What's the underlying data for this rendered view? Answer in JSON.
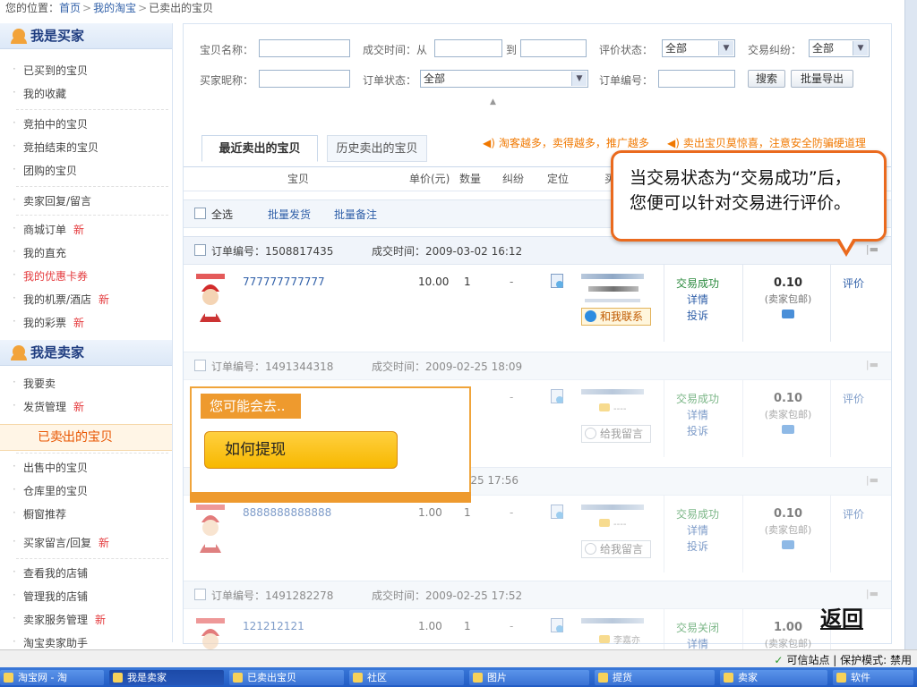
{
  "breadcrumb": {
    "prefix": "您的位置：",
    "home": "首页",
    "mytaobao": "我的淘宝",
    "current": "已卖出的宝贝",
    "sep": ">"
  },
  "sidebar": {
    "buyer_title": "我是买家",
    "buyer_items": [
      {
        "label": "已买到的宝贝",
        "new": ""
      },
      {
        "label": "我的收藏",
        "new": ""
      },
      {
        "label": "竞拍中的宝贝",
        "new": ""
      },
      {
        "label": "竞拍结束的宝贝",
        "new": ""
      },
      {
        "label": "团购的宝贝",
        "new": ""
      },
      {
        "label": "卖家回复/留言",
        "new": ""
      },
      {
        "label": "商城订单",
        "new": "新"
      },
      {
        "label": "我的直充",
        "new": ""
      },
      {
        "label": "我的优惠卡券",
        "new": ""
      },
      {
        "label": "我的机票/酒店",
        "new": "新"
      },
      {
        "label": "我的彩票",
        "new": "新"
      }
    ],
    "seller_title": "我是卖家",
    "seller_items": [
      {
        "label": "我要卖",
        "new": ""
      },
      {
        "label": "发货管理",
        "new": "新"
      },
      {
        "label": "已卖出的宝贝",
        "new": ""
      },
      {
        "label": "出售中的宝贝",
        "new": ""
      },
      {
        "label": "仓库里的宝贝",
        "new": ""
      },
      {
        "label": "橱窗推荐",
        "new": ""
      },
      {
        "label": "买家留言/回复",
        "new": "新"
      },
      {
        "label": "查看我的店铺",
        "new": ""
      },
      {
        "label": "管理我的店铺",
        "new": ""
      },
      {
        "label": "卖家服务管理",
        "new": "新"
      },
      {
        "label": "淘宝卖家助手",
        "new": ""
      }
    ]
  },
  "search": {
    "item_name": "宝贝名称：",
    "deal_time_from": "成交时间：从",
    "to": "到",
    "rating_status": "评价状态：",
    "rating_value": "全部",
    "dispute": "交易纠纷：",
    "dispute_value": "全部",
    "buyer_nick": "买家昵称：",
    "order_status": "订单状态：",
    "order_status_value": "全部",
    "order_no": "订单编号：",
    "search_btn": "搜索",
    "export_btn": "批量导出",
    "collapse": "▲"
  },
  "tabs": {
    "recent": "最近卖出的宝贝",
    "history": "历史卖出的宝贝"
  },
  "notices": {
    "n1": "淘客越多，卖得越多，推广越多",
    "n2": "卖出宝贝莫惊喜，注意安全防骗硬道理"
  },
  "columns": {
    "item": "宝贝",
    "price": "单价(元)",
    "qty": "数量",
    "dispute": "纠纷",
    "locate": "定位",
    "more": "买"
  },
  "toolbar": {
    "select_all": "全选",
    "batch_ship": "批量发货",
    "batch_note": "批量备注"
  },
  "orders": [
    {
      "order_label": "订单编号：",
      "order_no": "1508817435",
      "time_label": "成交时间：",
      "time": "2009-03-02 16:12",
      "item": "777777777777",
      "price": "10.00",
      "qty": "1",
      "dispute": "-",
      "status": "交易成功",
      "detail": "详情",
      "complain": "投诉",
      "amount": "0.10",
      "shipping": "(卖家包邮)",
      "rate": "评价",
      "contact": "和我联系"
    },
    {
      "order_label": "订单编号：",
      "order_no": "1491344318",
      "time_label": "成交时间：",
      "time": "2009-02-25 18:09",
      "item": "",
      "price": "",
      "qty": "",
      "dispute": "-",
      "status": "交易成功",
      "detail": "详情",
      "complain": "投诉",
      "amount": "0.10",
      "shipping": "(卖家包邮)",
      "rate": "评价",
      "contact": "给我留言",
      "bubble": "----"
    },
    {
      "order_label": "",
      "order_no": "",
      "time_label": "",
      "time": "-25 17:56",
      "item": "8888888888888",
      "price": "1.00",
      "qty": "1",
      "dispute": "-",
      "status": "交易成功",
      "detail": "详情",
      "complain": "投诉",
      "amount": "0.10",
      "shipping": "(卖家包邮)",
      "rate": "评价",
      "contact": "给我留言",
      "bubble": "----"
    },
    {
      "order_label": "订单编号：",
      "order_no": "1491282278",
      "time_label": "成交时间：",
      "time": "2009-02-25 17:52",
      "item": "121212121",
      "price": "1.00",
      "qty": "1",
      "dispute": "-",
      "status": "交易关闭",
      "detail": "详情",
      "complain": "",
      "amount": "1.00",
      "shipping": "(卖家包邮)",
      "rate": "",
      "contact": "",
      "bubble": "李嘉亦"
    }
  ],
  "callout": {
    "line1": "当交易状态为“交易成功”后，",
    "line2": "您便可以针对交易进行评价。"
  },
  "popup": {
    "header": "您可能会去..",
    "link": "如何提现"
  },
  "back_link": "返回",
  "ie_status": {
    "zone": "可信站点 | 保护模式: 禁用"
  },
  "taskbar": [
    "淘宝网 - 淘",
    "我是卖家",
    "已卖出宝贝",
    "社区",
    "图片",
    "提货",
    "卖家",
    "软件"
  ],
  "colors": {
    "brand_orange": "#ea6a1e",
    "link_blue": "#2f5fa8",
    "success_green": "#2b8a3e",
    "new_red": "#e4393c"
  }
}
